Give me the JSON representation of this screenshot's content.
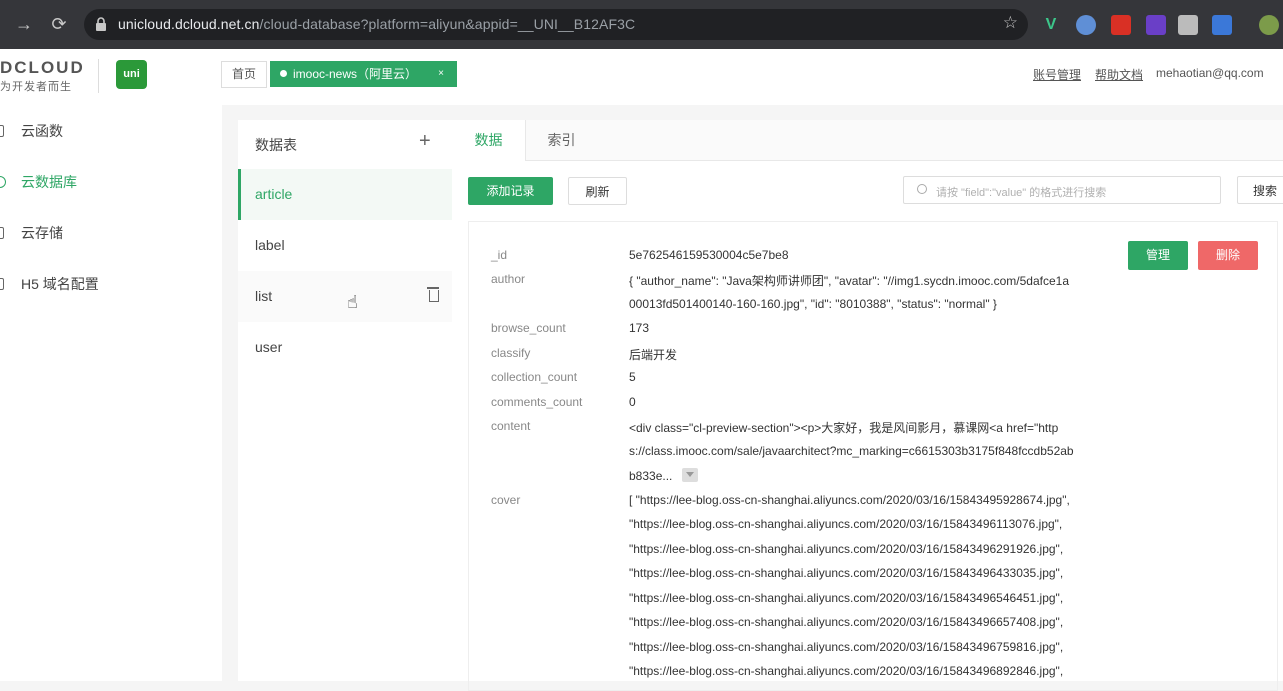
{
  "browser": {
    "url_host": "unicloud.dcloud.net.cn",
    "url_path": "/cloud-database?platform=aliyun&appid=__UNI__B12AF3C"
  },
  "header": {
    "logo_text": "DCLOUD",
    "logo_sub": "为开发者而生",
    "uni_logo": "uni",
    "home_tab": "首页",
    "project_tab": "imooc-news（阿里云）",
    "project_close": "×",
    "account_link": "账号管理",
    "help_link": "帮助文档",
    "email": "mehaotian@qq.com"
  },
  "sidebar": {
    "items": [
      {
        "label": "云函数"
      },
      {
        "label": "云数据库"
      },
      {
        "label": "云存储"
      },
      {
        "label": "H5 域名配置"
      }
    ]
  },
  "tables": {
    "heading": "数据表",
    "add": "+",
    "items": [
      {
        "name": "article"
      },
      {
        "name": "label"
      },
      {
        "name": "list"
      },
      {
        "name": "user"
      }
    ]
  },
  "main": {
    "tabs": [
      {
        "label": "数据"
      },
      {
        "label": "索引"
      }
    ],
    "add_record": "添加记录",
    "refresh": "刷新",
    "search_placeholder": "请按 \"field\":\"value\" 的格式进行搜索",
    "search_button": "搜索",
    "manage": "管理",
    "delete": "删除",
    "record": {
      "fields": [
        {
          "key": "_id",
          "lines": [
            "5e762546159530004c5e7be8"
          ]
        },
        {
          "key": "author",
          "lines": [
            "{ \"author_name\": \"Java架构师讲师团\", \"avatar\": \"//img1.sycdn.imooc.com/5dafce1a",
            "00013fd501400140-160-160.jpg\", \"id\": \"8010388\", \"status\": \"normal\" }"
          ]
        },
        {
          "key": "browse_count",
          "lines": [
            "173"
          ]
        },
        {
          "key": "classify",
          "lines": [
            "后端开发"
          ]
        },
        {
          "key": "collection_count",
          "lines": [
            "5"
          ]
        },
        {
          "key": "comments_count",
          "lines": [
            "0"
          ]
        },
        {
          "key": "content",
          "lines": [
            "<div class=\"cl-preview-section\"><p>大家好，我是风间影月，慕课网<a href=\"http",
            "s://class.imooc.com/sale/javaarchitect?mc_marking=c6615303b3175f848fccdb52ab",
            "b833e..."
          ]
        },
        {
          "key": "cover",
          "lines": [
            "[ \"https://lee-blog.oss-cn-shanghai.aliyuncs.com/2020/03/16/15843495928674.jpg\",",
            "\"https://lee-blog.oss-cn-shanghai.aliyuncs.com/2020/03/16/15843496113076.jpg\",",
            "\"https://lee-blog.oss-cn-shanghai.aliyuncs.com/2020/03/16/15843496291926.jpg\",",
            "\"https://lee-blog.oss-cn-shanghai.aliyuncs.com/2020/03/16/15843496433035.jpg\",",
            "\"https://lee-blog.oss-cn-shanghai.aliyuncs.com/2020/03/16/15843496546451.jpg\",",
            "\"https://lee-blog.oss-cn-shanghai.aliyuncs.com/2020/03/16/15843496657408.jpg\",",
            "\"https://lee-blog.oss-cn-shanghai.aliyuncs.com/2020/03/16/15843496759816.jpg\",",
            "\"https://lee-blog.oss-cn-shanghai.aliyuncs.com/2020/03/16/15843496892846.jpg\","
          ]
        }
      ]
    }
  }
}
